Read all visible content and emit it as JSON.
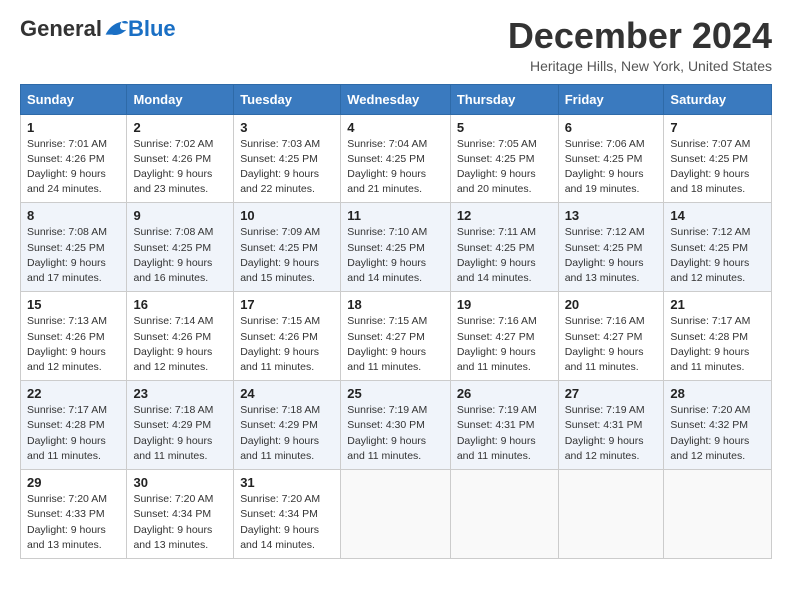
{
  "logo": {
    "general": "General",
    "blue": "Blue"
  },
  "title": "December 2024",
  "location": "Heritage Hills, New York, United States",
  "days_of_week": [
    "Sunday",
    "Monday",
    "Tuesday",
    "Wednesday",
    "Thursday",
    "Friday",
    "Saturday"
  ],
  "weeks": [
    [
      {
        "day": "1",
        "sunrise": "7:01 AM",
        "sunset": "4:26 PM",
        "daylight": "9 hours and 24 minutes."
      },
      {
        "day": "2",
        "sunrise": "7:02 AM",
        "sunset": "4:26 PM",
        "daylight": "9 hours and 23 minutes."
      },
      {
        "day": "3",
        "sunrise": "7:03 AM",
        "sunset": "4:25 PM",
        "daylight": "9 hours and 22 minutes."
      },
      {
        "day": "4",
        "sunrise": "7:04 AM",
        "sunset": "4:25 PM",
        "daylight": "9 hours and 21 minutes."
      },
      {
        "day": "5",
        "sunrise": "7:05 AM",
        "sunset": "4:25 PM",
        "daylight": "9 hours and 20 minutes."
      },
      {
        "day": "6",
        "sunrise": "7:06 AM",
        "sunset": "4:25 PM",
        "daylight": "9 hours and 19 minutes."
      },
      {
        "day": "7",
        "sunrise": "7:07 AM",
        "sunset": "4:25 PM",
        "daylight": "9 hours and 18 minutes."
      }
    ],
    [
      {
        "day": "8",
        "sunrise": "7:08 AM",
        "sunset": "4:25 PM",
        "daylight": "9 hours and 17 minutes."
      },
      {
        "day": "9",
        "sunrise": "7:08 AM",
        "sunset": "4:25 PM",
        "daylight": "9 hours and 16 minutes."
      },
      {
        "day": "10",
        "sunrise": "7:09 AM",
        "sunset": "4:25 PM",
        "daylight": "9 hours and 15 minutes."
      },
      {
        "day": "11",
        "sunrise": "7:10 AM",
        "sunset": "4:25 PM",
        "daylight": "9 hours and 14 minutes."
      },
      {
        "day": "12",
        "sunrise": "7:11 AM",
        "sunset": "4:25 PM",
        "daylight": "9 hours and 14 minutes."
      },
      {
        "day": "13",
        "sunrise": "7:12 AM",
        "sunset": "4:25 PM",
        "daylight": "9 hours and 13 minutes."
      },
      {
        "day": "14",
        "sunrise": "7:12 AM",
        "sunset": "4:25 PM",
        "daylight": "9 hours and 12 minutes."
      }
    ],
    [
      {
        "day": "15",
        "sunrise": "7:13 AM",
        "sunset": "4:26 PM",
        "daylight": "9 hours and 12 minutes."
      },
      {
        "day": "16",
        "sunrise": "7:14 AM",
        "sunset": "4:26 PM",
        "daylight": "9 hours and 12 minutes."
      },
      {
        "day": "17",
        "sunrise": "7:15 AM",
        "sunset": "4:26 PM",
        "daylight": "9 hours and 11 minutes."
      },
      {
        "day": "18",
        "sunrise": "7:15 AM",
        "sunset": "4:27 PM",
        "daylight": "9 hours and 11 minutes."
      },
      {
        "day": "19",
        "sunrise": "7:16 AM",
        "sunset": "4:27 PM",
        "daylight": "9 hours and 11 minutes."
      },
      {
        "day": "20",
        "sunrise": "7:16 AM",
        "sunset": "4:27 PM",
        "daylight": "9 hours and 11 minutes."
      },
      {
        "day": "21",
        "sunrise": "7:17 AM",
        "sunset": "4:28 PM",
        "daylight": "9 hours and 11 minutes."
      }
    ],
    [
      {
        "day": "22",
        "sunrise": "7:17 AM",
        "sunset": "4:28 PM",
        "daylight": "9 hours and 11 minutes."
      },
      {
        "day": "23",
        "sunrise": "7:18 AM",
        "sunset": "4:29 PM",
        "daylight": "9 hours and 11 minutes."
      },
      {
        "day": "24",
        "sunrise": "7:18 AM",
        "sunset": "4:29 PM",
        "daylight": "9 hours and 11 minutes."
      },
      {
        "day": "25",
        "sunrise": "7:19 AM",
        "sunset": "4:30 PM",
        "daylight": "9 hours and 11 minutes."
      },
      {
        "day": "26",
        "sunrise": "7:19 AM",
        "sunset": "4:31 PM",
        "daylight": "9 hours and 11 minutes."
      },
      {
        "day": "27",
        "sunrise": "7:19 AM",
        "sunset": "4:31 PM",
        "daylight": "9 hours and 12 minutes."
      },
      {
        "day": "28",
        "sunrise": "7:20 AM",
        "sunset": "4:32 PM",
        "daylight": "9 hours and 12 minutes."
      }
    ],
    [
      {
        "day": "29",
        "sunrise": "7:20 AM",
        "sunset": "4:33 PM",
        "daylight": "9 hours and 13 minutes."
      },
      {
        "day": "30",
        "sunrise": "7:20 AM",
        "sunset": "4:34 PM",
        "daylight": "9 hours and 13 minutes."
      },
      {
        "day": "31",
        "sunrise": "7:20 AM",
        "sunset": "4:34 PM",
        "daylight": "9 hours and 14 minutes."
      },
      null,
      null,
      null,
      null
    ]
  ],
  "labels": {
    "sunrise": "Sunrise: ",
    "sunset": "Sunset: ",
    "daylight": "Daylight: "
  }
}
